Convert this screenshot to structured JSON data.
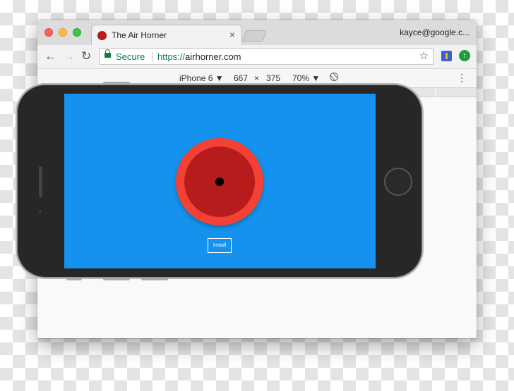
{
  "browser": {
    "tab": {
      "title": "The Air Horner",
      "close_glyph": "×",
      "favicon_color": "#b71c1c"
    },
    "profile_label": "kayce@google.c...",
    "nav": {
      "back_glyph": "←",
      "forward_glyph": "→",
      "reload_glyph": "↻"
    },
    "omnibox": {
      "secure_label": "Secure",
      "url_scheme": "https://",
      "url_host": "airhorner.com",
      "secure_color": "#0b8043",
      "star_glyph": "☆"
    },
    "extensions": [
      {
        "name": "extension-icon",
        "color": "#3b5fd9"
      },
      {
        "name": "update-icon",
        "glyph": "↑",
        "color": "#1e9e3e"
      }
    ]
  },
  "devtools": {
    "device": "iPhone 6 ▼",
    "width": "667",
    "times": "×",
    "height": "375",
    "zoom": "70% ▼",
    "menu_glyph": "⋮"
  },
  "app": {
    "background_color": "#1592ee",
    "horn_outer_color": "#f34235",
    "horn_inner_color": "#b71c1c",
    "install_label": "Install"
  }
}
